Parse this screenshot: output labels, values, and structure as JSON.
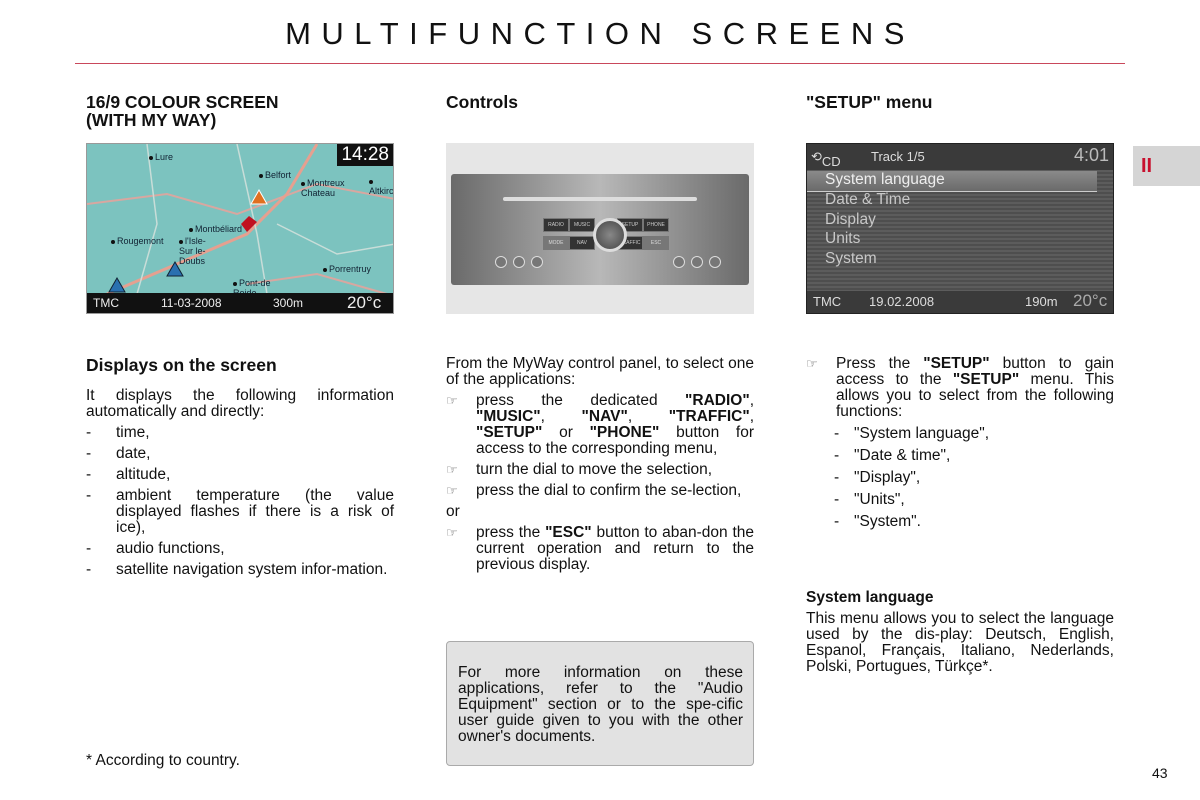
{
  "page": {
    "title": "MULTIFUNCTION SCREENS",
    "page_number": "43",
    "section_tab": "II",
    "accent_color": "#c9485b"
  },
  "col1": {
    "heading_line1": "16/9 COLOUR SCREEN",
    "heading_line2": "(WITH MY WAY)",
    "map": {
      "clock": "14:28",
      "tmc": "TMC",
      "date": "11-03-2008",
      "altitude": "300m",
      "temperature": "20°c",
      "cities": [
        "Lure",
        "Belfort",
        "Montreux Chateau",
        "Altkirch",
        "Montbéliard",
        "Rougemont",
        "l'Isle-Sur le-Doubs",
        "Porrentruy",
        "Pont-de Roide"
      ]
    },
    "displays_heading": "Displays on the screen",
    "intro": "It displays the following information automatically and directly:",
    "items": [
      "time,",
      "date,",
      "altitude,",
      "ambient temperature (the value displayed flashes if there is a risk of ice),",
      "audio functions,",
      "satellite navigation system infor-mation."
    ],
    "footnote": "* According to country."
  },
  "col2": {
    "heading": "Controls",
    "panel_buttons": [
      "RADIO",
      "MUSIC",
      "SETUP",
      "PHONE",
      "MODE",
      "NAV",
      "TRAFFIC",
      "ESC"
    ],
    "intro": "From the MyWay control panel, to select one of the applications:",
    "bullet1": {
      "t1": "press the dedicated ",
      "b1": "\"RADIO\"",
      "t2": ", ",
      "b2": "\"MUSIC\"",
      "t3": ", ",
      "b3": "\"NAV\"",
      "t4": ", ",
      "b4": "\"TRAFFIC\"",
      "t5": ", ",
      "b5": "\"SETUP\"",
      "t6": " or ",
      "b6": "\"PHONE\"",
      "t7": " button for access to the corresponding menu,"
    },
    "bullet2": "turn the dial to move the selection,",
    "bullet3": "press the dial to confirm the se-lection,",
    "or": "or",
    "bullet4": {
      "t1": "press the ",
      "b1": "\"ESC\"",
      "t2": " button to aban-don the current operation and return to the previous display."
    },
    "info_box": "For more information on these applications, refer to the \"Audio Equipment\" section or to the spe-cific user guide given to you with the other owner's documents."
  },
  "col3": {
    "heading": "\"SETUP\" menu",
    "screen": {
      "source": "CD",
      "track": "Track 1/5",
      "clock": "4:01",
      "menu": [
        "System language",
        "Date & Time",
        "Display",
        "Units",
        "System"
      ],
      "selected": 0,
      "tmc": "TMC",
      "date": "19.02.2008",
      "altitude": "190m",
      "temperature": "20°c"
    },
    "bullet": {
      "t1": "Press the ",
      "b1": "\"SETUP\"",
      "t2": " button to gain access to the ",
      "b2": "\"SETUP\"",
      "t3": " menu. This allows you to select from the following functions:"
    },
    "functions": [
      "\"System language\",",
      "\"Date & time\",",
      "\"Display\",",
      "\"Units\",",
      "\"System\"."
    ],
    "lang_heading": "System language",
    "lang_text": "This menu allows you to select the language used by the dis-play: Deutsch, English, Espanol, Français, Italiano, Nederlands, Polski, Portugues, Türkçe*."
  },
  "icons": {
    "bullet": "pointing-hand-icon"
  }
}
